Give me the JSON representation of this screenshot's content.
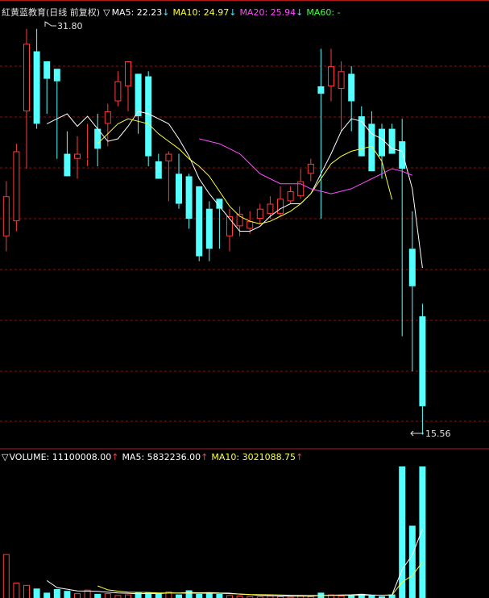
{
  "header": {
    "stock_name": "紅黄蓝教育",
    "period": "(日线 前复权)",
    "collapse_glyph": "▽",
    "ma5_label": "MA5: 22.23",
    "ma10_label": "MA10: 24.97",
    "ma20_label": "MA20: 25.94",
    "ma60_label": "MA60: -",
    "down_arrow": "↓"
  },
  "volume_header": {
    "collapse_glyph": "▽",
    "volume_label": "VOLUME: 11100008.00",
    "ma5_label": "MA5: 5832236.00",
    "ma10_label": "MA10: 3021088.75",
    "up_arrow": "↑"
  },
  "annotations": {
    "high_label": "31.80",
    "low_label": "15.56"
  },
  "colors": {
    "background": "#000000",
    "up": "#ff3b3b",
    "down": "#54ffff",
    "ma5": "#ffffff",
    "ma10": "#ffff3c",
    "ma20": "#ff4cff",
    "ma60": "#43ff43",
    "grid": "#8a1010"
  },
  "chart_data": [
    {
      "type": "candlestick",
      "title": "紅黄蓝教育(日线 前复权)",
      "ylim": [
        15.0,
        32.5
      ],
      "x": [
        1,
        2,
        3,
        4,
        5,
        6,
        7,
        8,
        9,
        10,
        11,
        12,
        13,
        14,
        15,
        16,
        17,
        18,
        19,
        20,
        21,
        22,
        23,
        24,
        25,
        26,
        27,
        28,
        29,
        30,
        31,
        32,
        33,
        34,
        35,
        36,
        37,
        38,
        39,
        40,
        41,
        42
      ],
      "series": [
        {
          "name": "OHLC",
          "open": [
            23.5,
            24.1,
            28.5,
            30.9,
            30.5,
            30.2,
            26.8,
            26.6,
            26.6,
            27.8,
            28.0,
            28.9,
            29.5,
            30.0,
            29.9,
            26.5,
            26.5,
            26.0,
            25.9,
            25.5,
            24.6,
            25.0,
            23.5,
            23.9,
            23.8,
            24.2,
            24.4,
            24.4,
            24.9,
            25.1,
            26.0,
            29.5,
            29.5,
            29.4,
            30.0,
            28.3,
            28.0,
            27.8,
            27.8,
            27.3,
            23.0,
            20.3
          ],
          "high": [
            25.7,
            27.2,
            31.8,
            31.8,
            30.5,
            30.2,
            27.7,
            27.5,
            28.0,
            28.4,
            28.8,
            30.1,
            30.5,
            30.0,
            30.1,
            26.8,
            26.9,
            26.8,
            26.0,
            25.5,
            24.9,
            25.0,
            24.6,
            24.7,
            24.5,
            24.8,
            25.1,
            25.5,
            25.5,
            26.2,
            26.6,
            31.0,
            31.0,
            30.5,
            30.3,
            28.7,
            28.5,
            28.0,
            28.0,
            28.2,
            24.5,
            20.8
          ],
          "low": [
            22.9,
            23.7,
            26.2,
            27.8,
            28.4,
            26.6,
            25.9,
            25.8,
            26.3,
            26.3,
            27.1,
            28.7,
            28.5,
            27.6,
            26.3,
            25.8,
            24.9,
            24.6,
            23.8,
            22.5,
            22.5,
            23.0,
            22.9,
            23.5,
            23.6,
            24.0,
            24.2,
            24.3,
            24.8,
            25.0,
            25.7,
            24.2,
            28.9,
            27.7,
            27.7,
            27.3,
            27.2,
            25.8,
            27.0,
            19.5,
            18.1,
            15.56
          ],
          "close": [
            25.1,
            26.9,
            31.2,
            28.0,
            29.8,
            29.7,
            25.9,
            26.8,
            26.6,
            27.0,
            28.5,
            29.7,
            30.5,
            28.3,
            26.7,
            25.8,
            26.8,
            24.8,
            24.2,
            22.7,
            23.0,
            24.6,
            24.3,
            24.4,
            24.1,
            24.6,
            24.8,
            25.0,
            25.3,
            25.7,
            26.4,
            29.2,
            30.3,
            30.1,
            28.9,
            26.7,
            26.1,
            26.7,
            26.8,
            26.2,
            21.5,
            16.7
          ]
        },
        {
          "name": "MA5",
          "start_index": 4,
          "values": [
            28.0,
            28.2,
            28.4,
            27.9,
            28.3,
            27.8,
            27.3,
            27.4,
            27.9,
            28.5,
            28.4,
            28.2,
            28.0,
            27.4,
            26.7,
            25.8,
            25.2,
            24.7,
            24.2,
            23.7,
            23.7,
            23.9,
            24.3,
            24.6,
            24.8,
            24.8,
            25.2,
            26.0,
            26.8,
            27.7,
            28.2,
            28.1,
            27.6,
            27.4,
            27.0,
            26.9,
            25.4,
            22.23
          ]
        },
        {
          "name": "MA10",
          "start_index": 9,
          "values": [
            27.2,
            27.6,
            28.0,
            28.2,
            28.1,
            28.0,
            27.6,
            27.3,
            27.0,
            26.6,
            26.3,
            25.9,
            25.3,
            24.7,
            24.3,
            24.1,
            24.0,
            24.1,
            24.3,
            24.5,
            24.8,
            25.2,
            25.8,
            26.4,
            26.7,
            26.9,
            27.0,
            27.1,
            26.5,
            24.97
          ]
        },
        {
          "name": "MA20",
          "start_index": 19,
          "values": [
            27.4,
            27.3,
            27.2,
            27.0,
            26.8,
            26.4,
            26.0,
            25.8,
            25.6,
            25.6,
            25.6,
            25.4,
            25.3,
            25.2,
            25.3,
            25.4,
            25.6,
            25.8,
            26.0,
            26.2,
            26.1,
            25.94
          ]
        }
      ]
    },
    {
      "type": "bar",
      "title": "VOLUME",
      "x": [
        1,
        2,
        3,
        4,
        5,
        6,
        7,
        8,
        9,
        10,
        11,
        12,
        13,
        14,
        15,
        16,
        17,
        18,
        19,
        20,
        21,
        22,
        23,
        24,
        25,
        26,
        27,
        28,
        29,
        30,
        31,
        32,
        33,
        34,
        35,
        36,
        37,
        38,
        39,
        40,
        41,
        42
      ],
      "series": [
        {
          "name": "VOLUME",
          "values": [
            3700000,
            1300000,
            1100000,
            800000,
            450000,
            750000,
            600000,
            400000,
            700000,
            350000,
            400000,
            250000,
            300000,
            500000,
            450000,
            350000,
            550000,
            300000,
            650000,
            350000,
            450000,
            350000,
            250000,
            200000,
            150000,
            150000,
            200000,
            150000,
            100000,
            200000,
            150000,
            450000,
            300000,
            200000,
            250000,
            350000,
            200000,
            150000,
            300000,
            11100008,
            6100000,
            11100008
          ]
        },
        {
          "name": "MA5",
          "values": [
            null,
            null,
            null,
            null,
            1470000,
            880000,
            740000,
            600000,
            580000,
            560000,
            490000,
            420000,
            400000,
            360000,
            380000,
            370000,
            430000,
            430000,
            460000,
            440000,
            460000,
            420000,
            410000,
            320000,
            280000,
            220000,
            190000,
            170000,
            150000,
            160000,
            160000,
            210000,
            240000,
            260000,
            270000,
            310000,
            260000,
            230000,
            260000,
            2420000,
            3620000,
            5832236
          ]
        },
        {
          "name": "MA10",
          "values": [
            null,
            null,
            null,
            null,
            null,
            null,
            null,
            null,
            null,
            1020000,
            690000,
            580000,
            500000,
            480000,
            470000,
            430000,
            420000,
            410000,
            410000,
            400000,
            400000,
            400000,
            370000,
            340000,
            300000,
            280000,
            270000,
            250000,
            230000,
            220000,
            210000,
            210000,
            210000,
            220000,
            220000,
            240000,
            240000,
            240000,
            260000,
            1350000,
            1900000,
            3021088.75
          ]
        }
      ]
    }
  ]
}
